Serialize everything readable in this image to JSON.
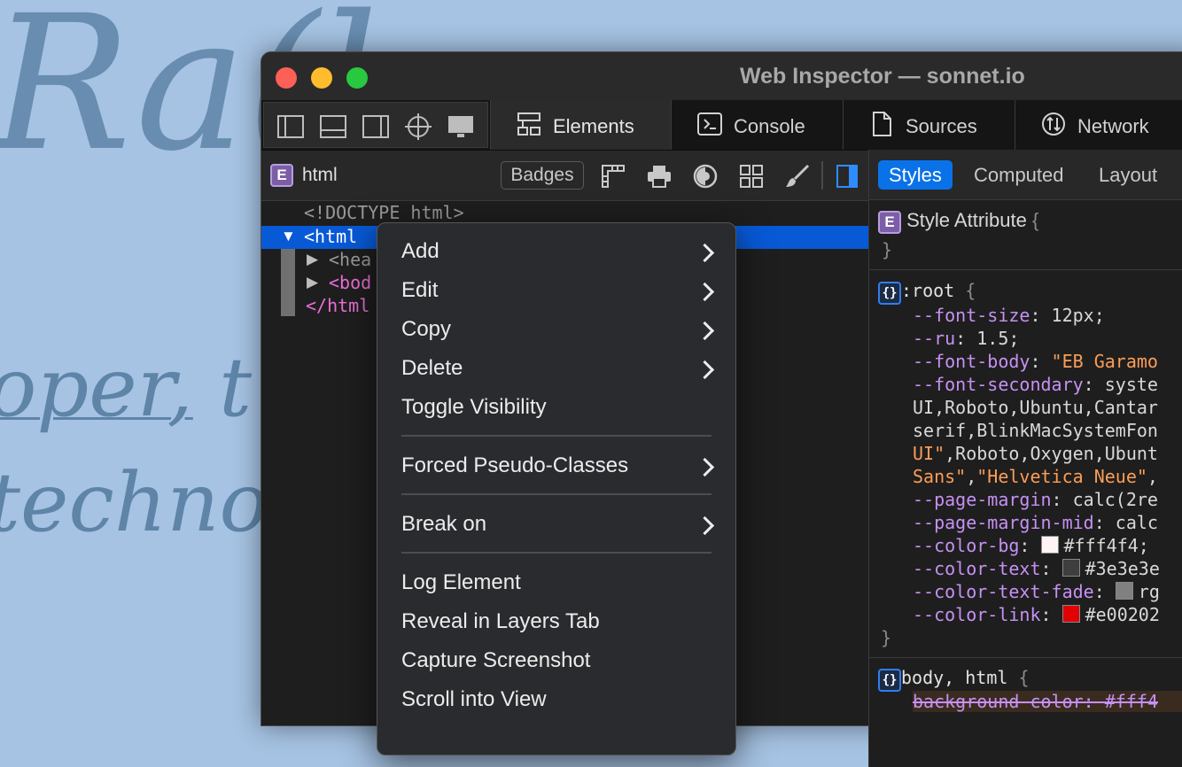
{
  "background": {
    "big_text": "Ra(l",
    "line2_underlined": "oper,",
    "line2_rest": " t",
    "line3": "techno"
  },
  "window": {
    "title": "Web Inspector — sonnet.io",
    "traffic_colors": [
      "#fe5f57",
      "#febc2e",
      "#28c840"
    ]
  },
  "dock_buttons": [
    "dock-left-icon",
    "dock-bottom-icon",
    "dock-right-icon",
    "crosshair-icon",
    "screen-icon"
  ],
  "tabs": [
    {
      "label": "Elements",
      "icon": "elements-icon",
      "active": true
    },
    {
      "label": "Console",
      "icon": "console-icon",
      "active": false
    },
    {
      "label": "Sources",
      "icon": "document-icon",
      "active": false
    },
    {
      "label": "Network",
      "icon": "network-icon",
      "active": false
    }
  ],
  "elements_bar": {
    "badge": "E",
    "node": "html",
    "badges_button": "Badges",
    "tools": [
      "ruler-icon",
      "print-icon",
      "contrast-icon",
      "grid-icon",
      "brush-icon",
      "sidebar-toggle-icon"
    ]
  },
  "dom_tree": {
    "doctype": "<!DOCTYPE html>",
    "html_open": "<html",
    "head": "<hea",
    "body": "<bod",
    "html_close": "</html"
  },
  "context_menu": {
    "items": [
      {
        "label": "Add",
        "submenu": true
      },
      {
        "label": "Edit",
        "submenu": true
      },
      {
        "label": "Copy",
        "submenu": true
      },
      {
        "label": "Delete",
        "submenu": true
      },
      {
        "label": "Toggle Visibility",
        "submenu": false
      },
      {
        "label": "Forced Pseudo-Classes",
        "submenu": true
      },
      {
        "label": "Break on",
        "submenu": true
      },
      {
        "label": "Log Element",
        "submenu": false
      },
      {
        "label": "Reveal in Layers Tab",
        "submenu": false
      },
      {
        "label": "Capture Screenshot",
        "submenu": false
      },
      {
        "label": "Scroll into View",
        "submenu": false
      }
    ]
  },
  "sidebar": {
    "tabs": [
      {
        "label": "Styles",
        "active": true
      },
      {
        "label": "Computed",
        "active": false
      },
      {
        "label": "Layout",
        "active": false
      }
    ],
    "style_attribute": {
      "badge": "E",
      "label": "Style Attribute",
      "open": "{",
      "close": "}"
    },
    "root_rule": {
      "badge": "{}",
      "selector": ":root",
      "open": "{",
      "close": "}",
      "decls": [
        {
          "prop": "--font-size",
          "value": "12px;"
        },
        {
          "prop": "--ru",
          "value": "1.5;"
        },
        {
          "prop": "--font-body",
          "value": "\"EB Garamo",
          "string": true
        },
        {
          "prop": "--font-secondary",
          "value": "syste"
        }
      ],
      "cont": [
        "UI,Roboto,Ubuntu,Cantar",
        "serif,BlinkMacSystemFon"
      ],
      "cont3_a": "UI\"",
      "cont3_b": ",Roboto,Oxygen,Ubunt",
      "cont4_a": "Sans\"",
      "cont4_b": ",",
      "cont4_c": "\"Helvetica Neue\"",
      "cont4_d": ",",
      "decls2": [
        {
          "prop": "--page-margin",
          "value": "calc(2re"
        },
        {
          "prop": "--page-margin-mid",
          "value": "calc"
        }
      ],
      "colors": [
        {
          "prop": "--color-bg",
          "value": "#fff4f4;",
          "swatch": "#fff4f4"
        },
        {
          "prop": "--color-text",
          "value": "#3e3e3e",
          "swatch": "#3e3e3e"
        },
        {
          "prop": "--color-text-fade",
          "value": "rg",
          "swatch": "#808080"
        },
        {
          "prop": "--color-link",
          "value": "#e00202",
          "swatch": "#e00202"
        }
      ]
    },
    "body_rule": {
      "badge": "{}",
      "selector": "body, html",
      "open": "{",
      "first_decl": "background-color: #fff4"
    }
  }
}
